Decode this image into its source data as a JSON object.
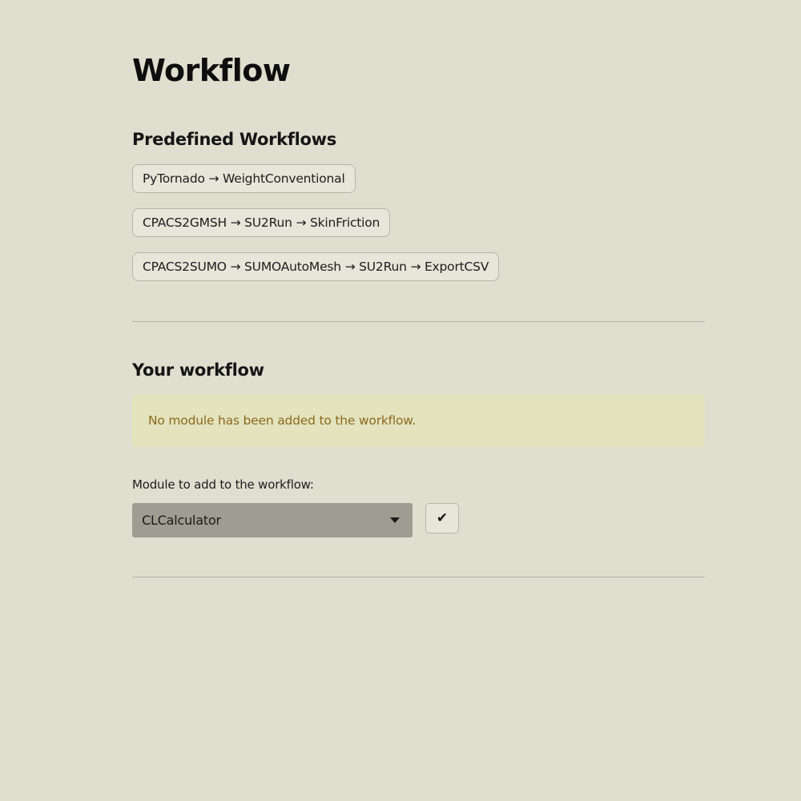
{
  "page": {
    "title": "Workflow"
  },
  "predefined": {
    "heading": "Predefined Workflows",
    "workflows": [
      "PyTornado → WeightConventional",
      "CPACS2GMSH → SU2Run → SkinFriction",
      "CPACS2SUMO → SUMOAutoMesh → SU2Run → ExportCSV"
    ]
  },
  "your_workflow": {
    "heading": "Your workflow",
    "empty_message": "No module has been added to the workflow.",
    "select_label": "Module to add to the workflow:",
    "selected_module": "CLCalculator",
    "confirm_label": "✔"
  },
  "icons": {
    "select_caret": "caret-down-icon",
    "confirm": "check-icon"
  },
  "colors": {
    "background": "#dfdfd0",
    "alert_background": "#e3e3bd",
    "alert_text": "#8c6a1e",
    "select_background": "#9d9d91"
  }
}
